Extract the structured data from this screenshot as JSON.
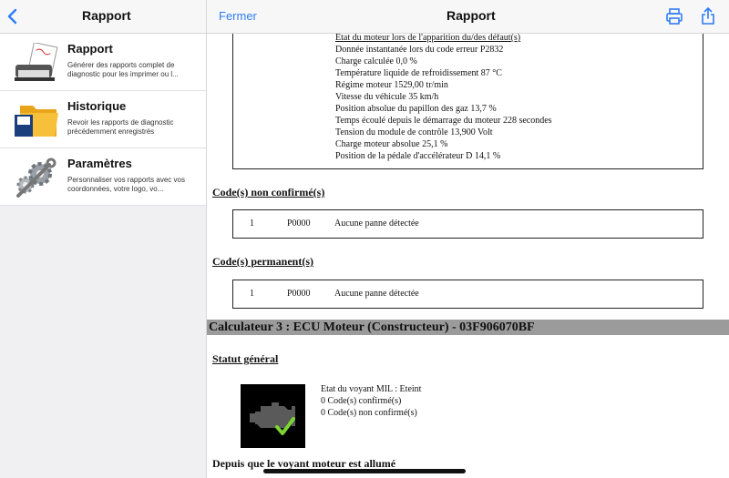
{
  "left_nav": {
    "title": "Rapport",
    "back_icon": "chevron-left-icon"
  },
  "right_nav": {
    "close_label": "Fermer",
    "title": "Rapport",
    "print_icon": "printer-icon",
    "share_icon": "share-icon"
  },
  "sidebar": {
    "items": [
      {
        "title": "Rapport",
        "desc": "Générer des rapports complet de diagnostic pour les imprimer ou l...",
        "icon": "report-printer-icon"
      },
      {
        "title": "Historique",
        "desc": "Revoir les rapports de diagnostic précédemment enregistrés",
        "icon": "folder-history-icon"
      },
      {
        "title": "Paramètres",
        "desc": "Personnaliser vos rapports avec vos coordonnées, votre logo, vo...",
        "icon": "gears-settings-icon"
      }
    ]
  },
  "report": {
    "freeze_frame": {
      "heading": "Etat du moteur lors de l'apparition du/des défaut(s)",
      "lines": [
        "Donnée instantanée lors du code erreur P2832",
        "Charge calculée 0,0 %",
        "Température liquide de refroidissement 87 °C",
        "Régime moteur 1529,00 tr/min",
        "Vitesse du véhicule 35 km/h",
        "Position absolue du papillon des gaz 13,7 %",
        "Temps écoulé depuis le démarrage du moteur 228 secondes",
        "Tension du module de contrôle 13,900 Volt",
        "Charge moteur absolue 25,1 %",
        "Position de la pédale d'accélérateur D 14,1 %"
      ]
    },
    "unconfirmed": {
      "heading": "Code(s) non confirmé(s)",
      "num": "1",
      "code": "P0000",
      "desc": "Aucune panne détectée"
    },
    "permanent": {
      "heading": "Code(s) permanent(s)",
      "num": "1",
      "code": "P0000",
      "desc": "Aucune panne détectée"
    },
    "calculator": "Calculateur 3 : ECU Moteur (Constructeur) - 03F906070BF",
    "status": {
      "heading": "Statut général",
      "mil": "Etat du voyant MIL : Eteint",
      "confirmed": "0 Code(s) confirmé(s)",
      "unconfirmed": "0 Code(s) non confirmé(s)",
      "icon": "engine-check-icon"
    },
    "since_mil": "Depuis que le voyant moteur est allumé"
  }
}
